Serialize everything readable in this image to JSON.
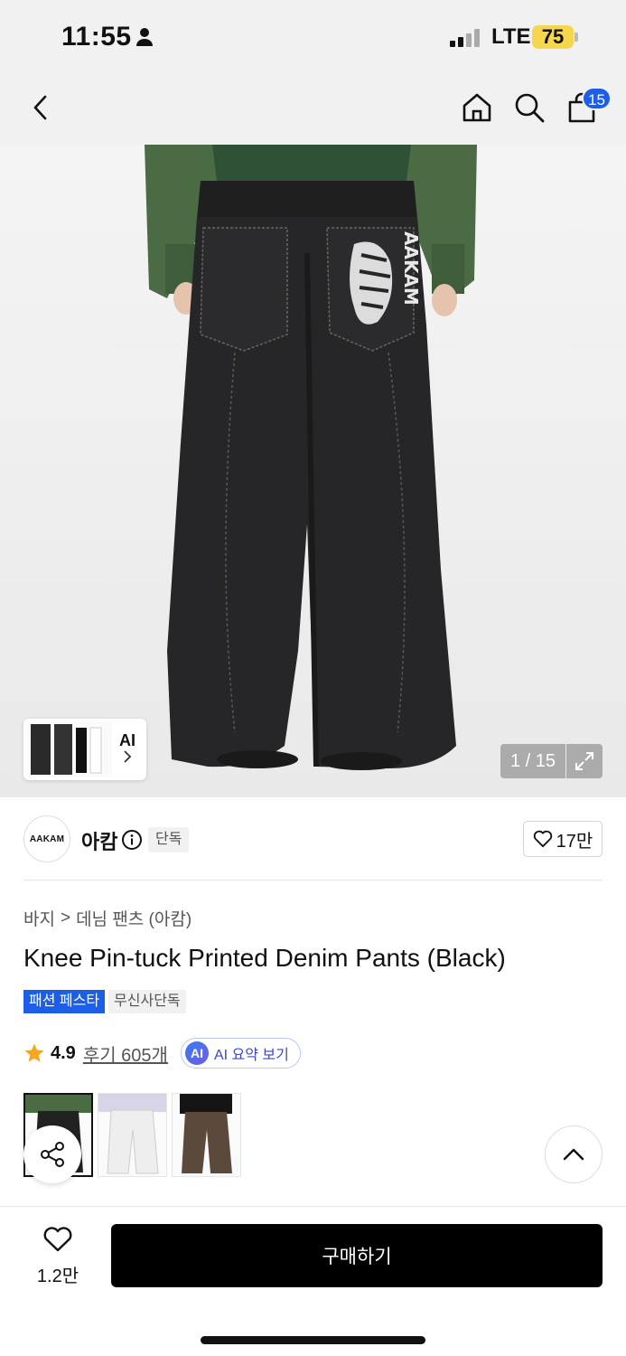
{
  "status_bar": {
    "time": "11:55",
    "network": "LTE",
    "battery": "75"
  },
  "nav": {
    "cart_count": "15"
  },
  "gallery": {
    "ai_label": "AI",
    "counter": "1 / 15"
  },
  "brand": {
    "logo_text": "AAKAM",
    "name": "아캄",
    "exclusive_tag": "단독",
    "likes": "17만"
  },
  "breadcrumb": {
    "category": "바지",
    "separator": ">",
    "subcategory": "데님 팬츠 (아캄)"
  },
  "product": {
    "title": "Knee Pin-tuck Printed Denim Pants (Black)",
    "badge_fest": "패션 페스타",
    "badge_exclusive": "무신사단독",
    "rating": "4.9",
    "reviews": "후기 605개",
    "ai_badge": "AI",
    "ai_summary": "AI 요약 보기"
  },
  "bottom": {
    "wish_count": "1.2만",
    "buy_label": "구매하기"
  },
  "colors": {
    "accent": "#1d5ee6",
    "star": "#f5a623",
    "buy_button": "#000000"
  }
}
